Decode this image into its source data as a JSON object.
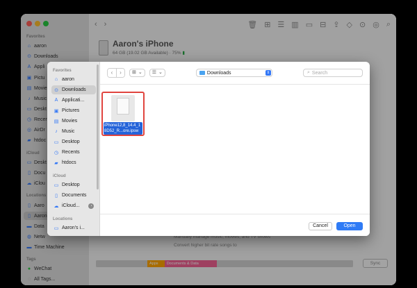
{
  "finder": {
    "sidebar": {
      "favorites_header": "Favorites",
      "favorites": [
        {
          "label": "aaron",
          "icon": "home-icon"
        },
        {
          "label": "Downloads",
          "icon": "download-icon"
        },
        {
          "label": "Appli",
          "icon": "applications-icon"
        },
        {
          "label": "Pictu",
          "icon": "pictures-icon"
        },
        {
          "label": "Movie",
          "icon": "movies-icon"
        },
        {
          "label": "Music",
          "icon": "music-icon"
        },
        {
          "label": "Deskt",
          "icon": "desktop-icon"
        },
        {
          "label": "Recen",
          "icon": "clock-icon"
        },
        {
          "label": "AirDr",
          "icon": "airdrop-icon"
        },
        {
          "label": "htdoc",
          "icon": "folder-icon"
        }
      ],
      "icloud_header": "iCloud",
      "icloud": [
        {
          "label": "Deskt",
          "icon": "desktop-icon"
        },
        {
          "label": "Docu",
          "icon": "document-icon"
        },
        {
          "label": "iClou",
          "icon": "cloud-icon"
        }
      ],
      "locations_header": "Locations",
      "locations": [
        {
          "label": "Aaro",
          "icon": "phone-icon"
        },
        {
          "label": "Aaron",
          "icon": "phone-icon"
        },
        {
          "label": "Data",
          "icon": "disk-icon"
        },
        {
          "label": "Netw",
          "icon": "network-icon"
        },
        {
          "label": "Time Machine",
          "icon": "disk-icon"
        }
      ],
      "tags_header": "Tags",
      "tags": [
        {
          "label": "WeChat",
          "color": "#28c840"
        },
        {
          "label": "All Tags..."
        }
      ]
    },
    "device": {
      "name": "Aaron's iPhone",
      "info": "64 GB (19.02 GB Available) · 75%",
      "battery": ""
    },
    "options": [
      "Manually manage music, movies, and TV shows",
      "Convert higher bit rate songs to"
    ],
    "storage": {
      "apps_label": "Apps",
      "docs_label": "Documents & Data"
    },
    "sync_label": "Sync"
  },
  "sheet": {
    "sidebar": {
      "favorites_header": "Favorites",
      "favorites": [
        {
          "label": "aaron",
          "icon": "home-icon",
          "glyph": "⌂"
        },
        {
          "label": "Downloads",
          "icon": "download-icon",
          "glyph": "⊙",
          "selected": true
        },
        {
          "label": "Applicati...",
          "icon": "applications-icon",
          "glyph": "A"
        },
        {
          "label": "Pictures",
          "icon": "pictures-icon",
          "glyph": "▣"
        },
        {
          "label": "Movies",
          "icon": "movies-icon",
          "glyph": "▤"
        },
        {
          "label": "Music",
          "icon": "music-icon",
          "glyph": "♪"
        },
        {
          "label": "Desktop",
          "icon": "desktop-icon",
          "glyph": "▭"
        },
        {
          "label": "Recents",
          "icon": "clock-icon",
          "glyph": "◷"
        },
        {
          "label": "htdocs",
          "icon": "folder-icon",
          "glyph": "▰"
        }
      ],
      "icloud_header": "iCloud",
      "icloud": [
        {
          "label": "Desktop",
          "icon": "desktop-icon",
          "glyph": "▭"
        },
        {
          "label": "Documents",
          "icon": "document-icon",
          "glyph": "▯"
        },
        {
          "label": "iCloud...",
          "icon": "cloud-icon",
          "glyph": "☁"
        }
      ],
      "locations_header": "Locations",
      "locations": [
        {
          "label": "Aaron's i...",
          "icon": "laptop-icon",
          "glyph": "▭"
        }
      ]
    },
    "toolbar": {
      "back": "‹",
      "forward": "›",
      "view_icon": "⊞",
      "group_icon": "☰",
      "chevron": "⌄",
      "location": "Downloads",
      "search_placeholder": "Search"
    },
    "files": [
      {
        "name": "iPhone12,8_14.4_18D52_R...ore.ipsw"
      }
    ],
    "footer": {
      "cancel_label": "Cancel",
      "open_label": "Open"
    }
  }
}
